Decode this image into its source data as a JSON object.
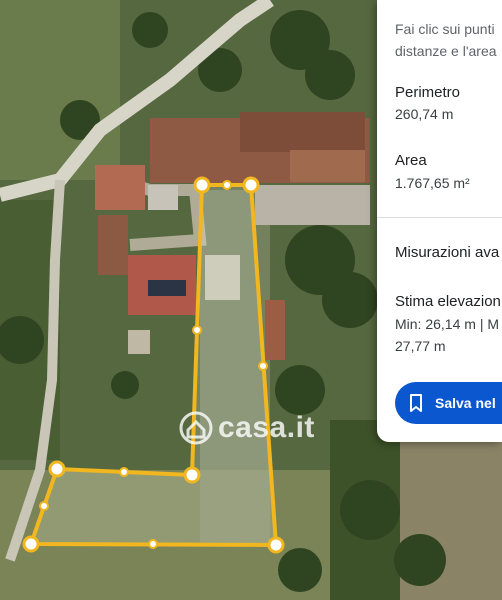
{
  "panel": {
    "hint_line1": "Fai clic sui punti",
    "hint_line2": "distanze e l'area",
    "perimeter_label": "Perimetro",
    "perimeter_value": "260,74 m",
    "area_label": "Area",
    "area_value": "1.767,65 m²",
    "measurements_title": "Misurazioni ava",
    "elevation_title": "Stima elevazion",
    "elevation_line1": "Min: 26,14 m | M",
    "elevation_line2": "27,77 m",
    "save_label": "Salva nel",
    "save_icon": "bookmark-icon"
  },
  "watermark": {
    "text": "casa.it",
    "icon": "house-logo-icon"
  },
  "map": {
    "measure_color": "#f2b61f",
    "vertex_fill": "#ffffff",
    "vertex_count": 7
  },
  "colors": {
    "accent": "#0b57d0"
  }
}
